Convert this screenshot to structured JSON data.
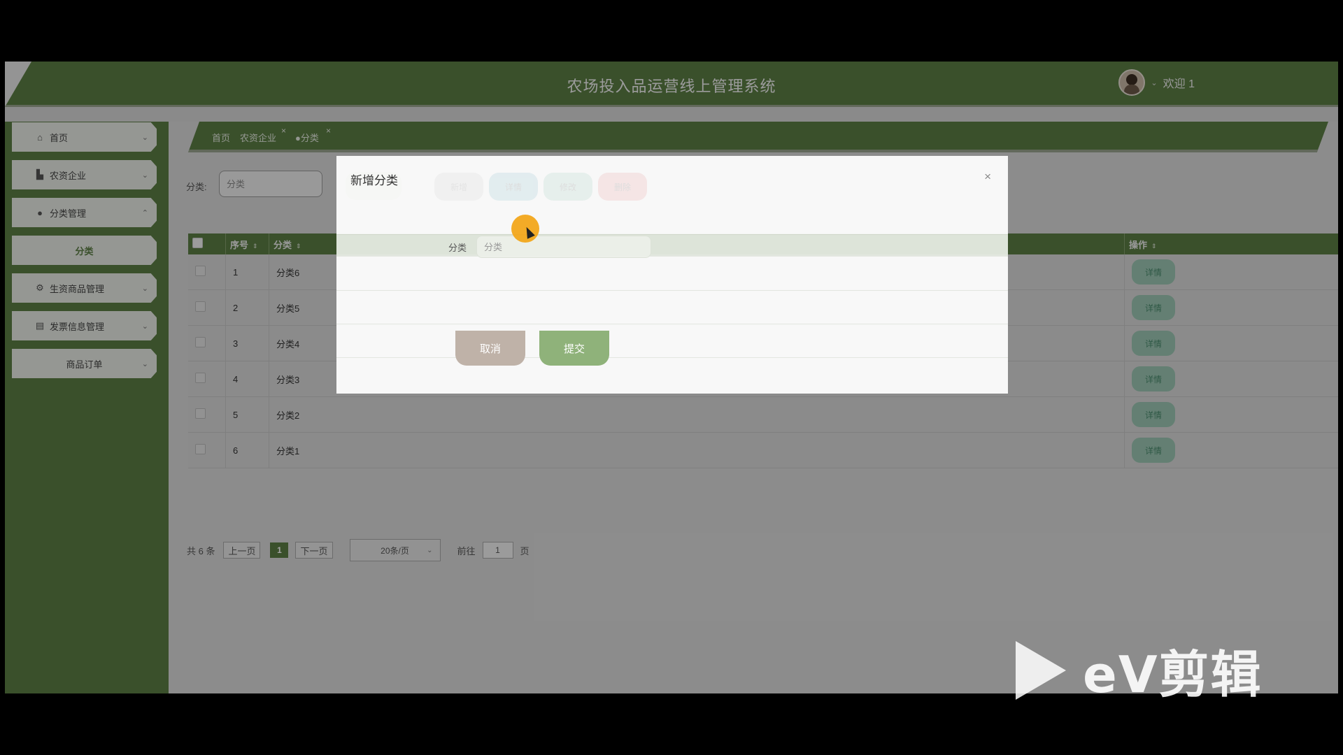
{
  "header": {
    "title": "农场投入品运营线上管理系统",
    "welcome": "欢迎 1"
  },
  "sidebar": {
    "items": [
      {
        "label": "首页",
        "icon": "home-icon"
      },
      {
        "label": "农资企业",
        "icon": "building-icon"
      },
      {
        "label": "分类管理",
        "icon": "category-icon"
      },
      {
        "label": "分类",
        "icon": ""
      },
      {
        "label": "生资商品管理",
        "icon": "chip-icon"
      },
      {
        "label": "发票信息管理",
        "icon": "invoice-icon"
      },
      {
        "label": "商品订单",
        "icon": ""
      }
    ]
  },
  "breadcrumb": {
    "home": "首页",
    "tab1": "农资企业",
    "tab2": "●分类",
    "close": "×"
  },
  "search": {
    "label": "分类:",
    "placeholder": "分类"
  },
  "toolbar": {
    "add": "新增",
    "detail": "详情",
    "edit": "修改",
    "delete": "删除"
  },
  "table": {
    "headers": [
      "序号",
      "分类",
      "操作"
    ],
    "rows": [
      {
        "no": "1",
        "name": "分类6"
      },
      {
        "no": "2",
        "name": "分类5"
      },
      {
        "no": "3",
        "name": "分类4"
      },
      {
        "no": "4",
        "name": "分类3"
      },
      {
        "no": "5",
        "name": "分类2"
      },
      {
        "no": "6",
        "name": "分类1"
      }
    ],
    "row_action": "详情"
  },
  "pagination": {
    "total": "共 6 条",
    "prev": "上一页",
    "current": "1",
    "next": "下一页",
    "page_size": "20条/页",
    "goto_label": "前往",
    "goto_value": "1",
    "page_suffix": "页"
  },
  "dialog": {
    "title": "新增分类",
    "close": "×",
    "field_label": "分类",
    "field_placeholder": "分类",
    "cancel": "取消",
    "submit": "提交"
  },
  "watermark": {
    "text": "eV剪辑"
  },
  "colors": {
    "primary": "#5b7d44",
    "accent_orange": "#f2a71b",
    "cancel": "#bfb2a8",
    "submit": "#8fb27a"
  }
}
